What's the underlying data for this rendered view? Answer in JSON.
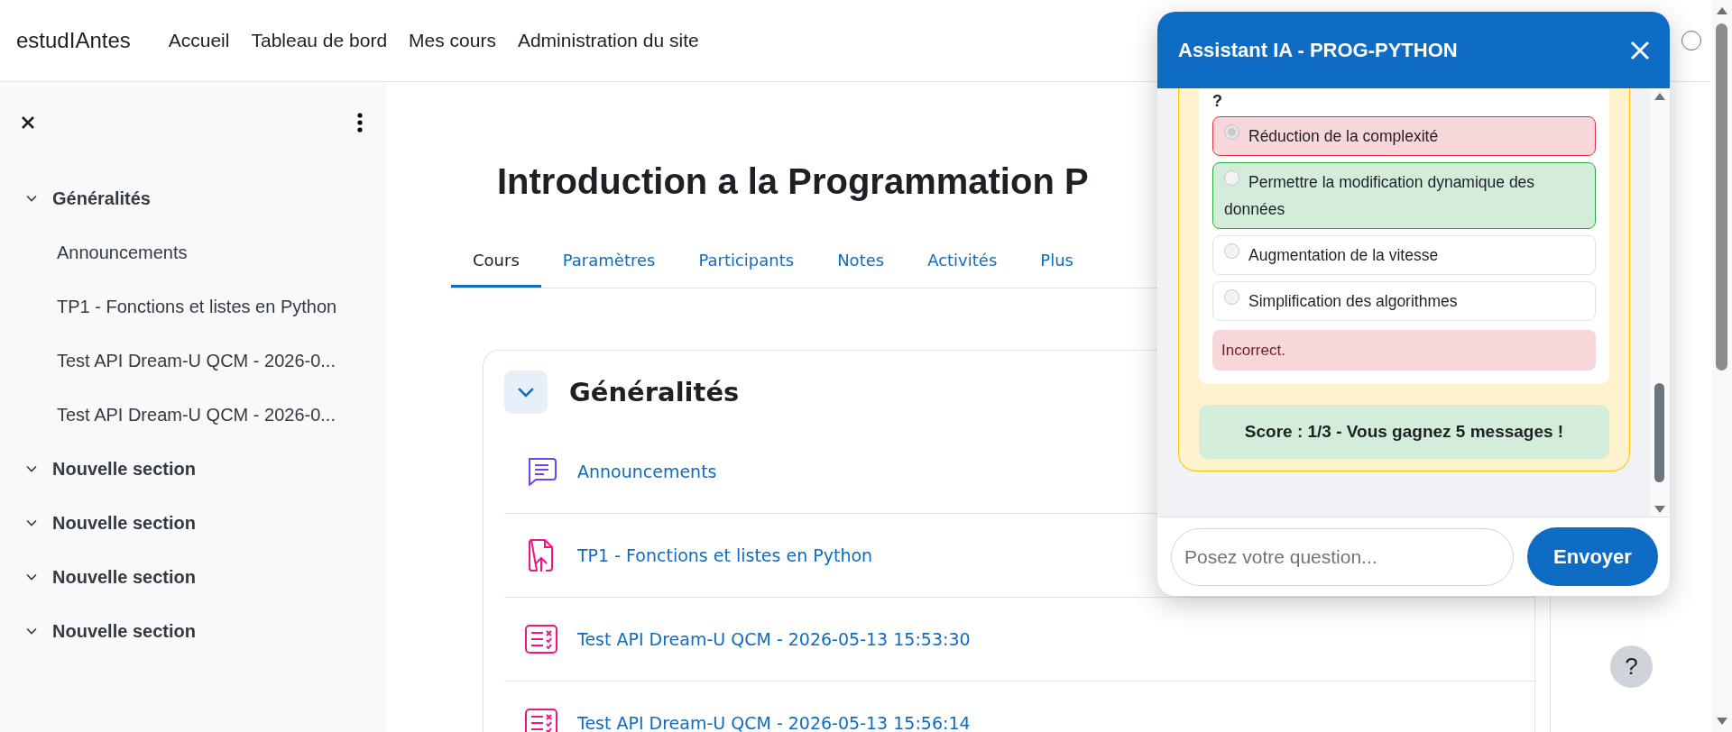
{
  "navbar": {
    "brand": "estudIAntes",
    "links": [
      "Accueil",
      "Tableau de bord",
      "Mes cours",
      "Administration du site"
    ]
  },
  "sidebar": {
    "sections": [
      {
        "title": "Généralités",
        "expanded": true,
        "children": [
          {
            "label": "Announcements"
          },
          {
            "label": "TP1 - Fonctions et listes en Python"
          },
          {
            "label": "Test API Dream-U QCM - 2026-0..."
          },
          {
            "label": "Test API Dream-U QCM - 2026-0..."
          }
        ]
      },
      {
        "title": "Nouvelle section",
        "expanded": true
      },
      {
        "title": "Nouvelle section",
        "expanded": true
      },
      {
        "title": "Nouvelle section",
        "expanded": true
      },
      {
        "title": "Nouvelle section",
        "expanded": true
      }
    ]
  },
  "course": {
    "title": "Introduction a la Programmation P",
    "tabs": [
      {
        "label": "Cours",
        "selected": true
      },
      {
        "label": "Paramètres",
        "selected": false
      },
      {
        "label": "Participants",
        "selected": false
      },
      {
        "label": "Notes",
        "selected": false
      },
      {
        "label": "Activités",
        "selected": false
      },
      {
        "label": "Plus",
        "selected": false
      }
    ],
    "section": {
      "title": "Généralités",
      "expanded": true,
      "activities": [
        {
          "kind": "forum",
          "label": "Announcements"
        },
        {
          "kind": "assign",
          "label": "TP1 - Fonctions et listes en Python"
        },
        {
          "kind": "quiz",
          "label": "Test API Dream-U QCM - 2026-05-13 15:53:30"
        },
        {
          "kind": "quiz",
          "label": "Test API Dream-U QCM - 2026-05-13 15:56:14"
        }
      ]
    }
  },
  "help_button": "?",
  "chat": {
    "title": "Assistant IA - PROG-PYTHON",
    "question": "?",
    "options": [
      {
        "label": "Réduction de la complexité",
        "selected": true,
        "kind": "wrong"
      },
      {
        "label": "Permettre la modification dynamique des données",
        "selected": false,
        "kind": "right"
      },
      {
        "label": "Augmentation de la vitesse",
        "selected": false,
        "kind": "plain"
      },
      {
        "label": "Simplification des algorithmes",
        "selected": false,
        "kind": "plain"
      }
    ],
    "feedback": {
      "kind": "incorrect",
      "text": "Incorrect."
    },
    "score": "Score : 1/3 - Vous gagnez 5 messages !",
    "input": {
      "placeholder": "Posez votre question..."
    },
    "send_button": "Envoyer"
  }
}
